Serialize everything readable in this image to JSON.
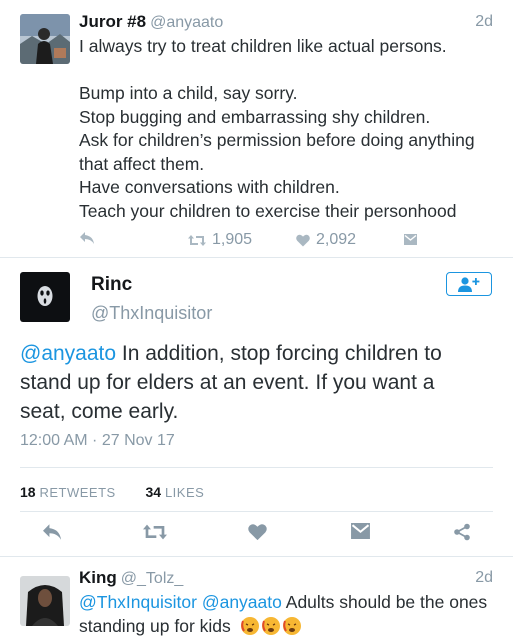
{
  "tweet1": {
    "name": "Juror #8",
    "handle": "@anyaato",
    "time": "2d",
    "lines": [
      "I always try to treat children like actual persons.",
      "",
      "Bump into a child, say sorry.",
      "Stop bugging and embarrassing shy children.",
      "Ask for children’s permission before doing anything",
      "that affect them.",
      "Have conversations with children.",
      "Teach your children to exercise their personhood"
    ],
    "retweets": "1,905",
    "likes": "2,092"
  },
  "main_tweet": {
    "name": "Rinc",
    "handle": "@ThxInquisitor",
    "mention": "@anyaato",
    "line1_rest": " In addition, stop forcing children to",
    "line2": "stand up for elders at an event. If you want a",
    "line3": "seat, come early.",
    "timestamp": "12:00 AM · 27 Nov 17",
    "retweet_count": "18",
    "retweet_label": "RETWEETS",
    "like_count": "34",
    "like_label": "LIKES"
  },
  "tweet3": {
    "name": "King",
    "handle": "@_Tolz_",
    "time": "2d",
    "mention1": "@ThxInquisitor",
    "mention2": "@anyaato",
    "line1_rest": " Adults should be the ones",
    "line2": "standing up for kids"
  },
  "colors": {
    "accent": "#1b95e0",
    "muted": "#8899a6",
    "divider": "#e1e8ed",
    "text": "#292f33"
  },
  "icons": [
    "reply-icon",
    "retweet-icon",
    "heart-icon",
    "dm-icon",
    "share-icon",
    "follow-icon"
  ]
}
